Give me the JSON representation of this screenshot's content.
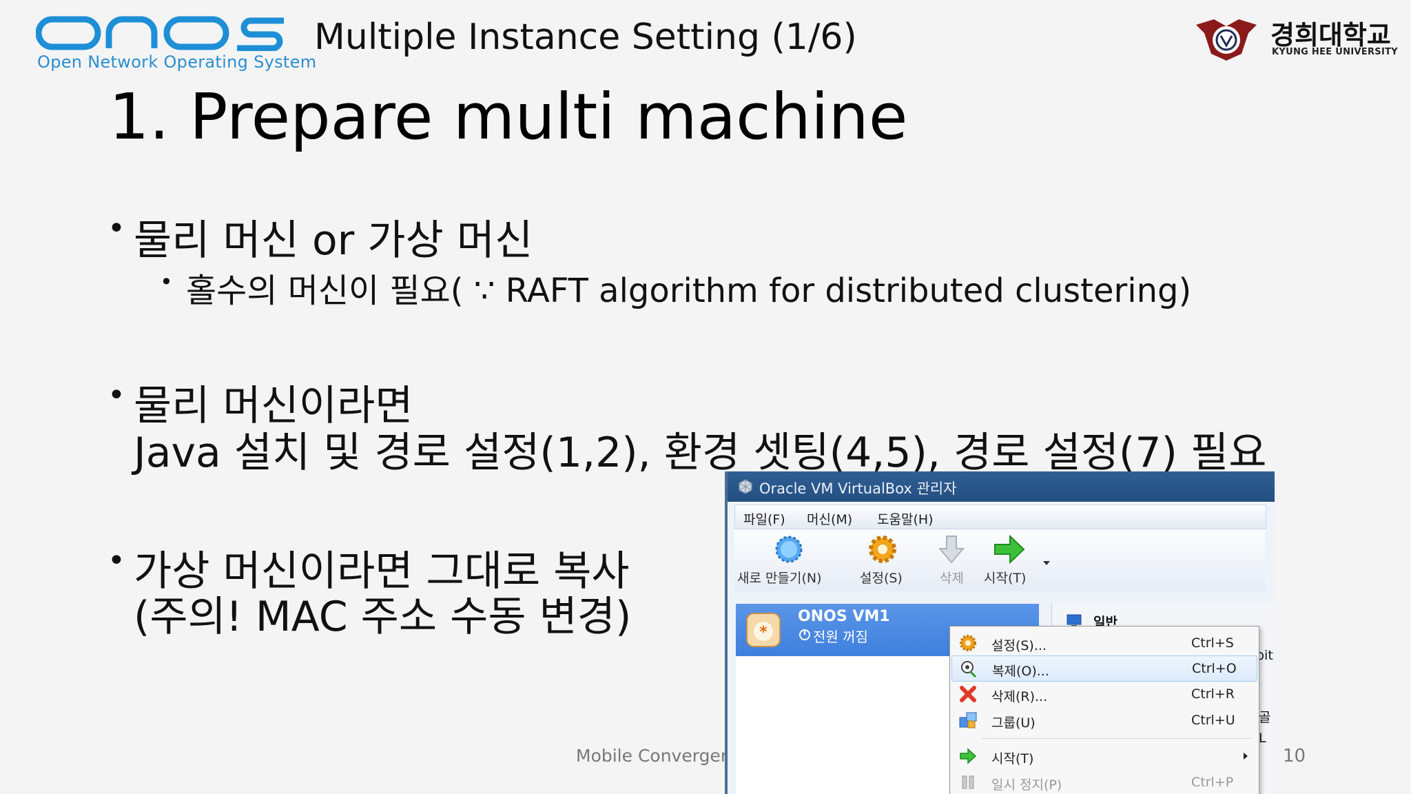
{
  "header": {
    "logo_word": "onos",
    "logo_subtitle": "Open Network Operating System",
    "title": "Multiple Instance Setting (1/6)",
    "university_name": "경희대학교",
    "university_sub": "KYUNG HEE UNIVERSITY"
  },
  "slide": {
    "title": "1. Prepare multi machine",
    "bullets": [
      {
        "lines": [
          "물리 머신 or 가상 머신"
        ],
        "sub": [
          "홀수의 머신이 필요( ∵ RAFT algorithm  for distributed  clustering)"
        ]
      },
      {
        "lines": [
          "물리 머신이라면",
          "Java 설치 및 경로 설정(1,2), 환경 셋팅(4,5), 경로 설정(7) 필요"
        ]
      },
      {
        "lines": [
          "가상 머신이라면 그대로 복사",
          "(주의! MAC 주소 수동 변경)"
        ]
      }
    ]
  },
  "footer": {
    "left_text": "Mobile Convergen",
    "page_number": "10"
  },
  "vbox": {
    "window_title": "Oracle VM VirtualBox 관리자",
    "menu": [
      "파일(F)",
      "머신(M)",
      "도움말(H)"
    ],
    "toolbar": [
      "새로 만들기(N)",
      "설정(S)",
      "삭제",
      "시작(T)"
    ],
    "vm": {
      "name": "ONOS VM1",
      "state": "전원 꺼짐"
    },
    "panel_tab": "일반",
    "right_edge": [
      "pit",
      "골",
      "L"
    ],
    "context_menu": [
      {
        "label": "설정(S)...",
        "shortcut": "Ctrl+S",
        "icon": "gear-icon"
      },
      {
        "label": "복제(O)...",
        "shortcut": "Ctrl+O",
        "icon": "clone-sheep-icon",
        "highlighted": true
      },
      {
        "label": "삭제(R)...",
        "shortcut": "Ctrl+R",
        "icon": "red-x-icon"
      },
      {
        "label": "그룹(U)",
        "shortcut": "Ctrl+U",
        "icon": "group-icon"
      },
      {
        "label": "시작(T)",
        "shortcut": "",
        "icon": "green-arrow-icon",
        "has_submenu": true
      },
      {
        "label": "일시 정지(P)",
        "shortcut": "Ctrl+P",
        "icon": "pause-icon"
      }
    ]
  },
  "colors": {
    "onos_blue": "#1e8fd6",
    "onos_navy": "#1b2e66",
    "vbox_titlebar": "#2f5f95",
    "selection_blue": "#4a88e0"
  }
}
